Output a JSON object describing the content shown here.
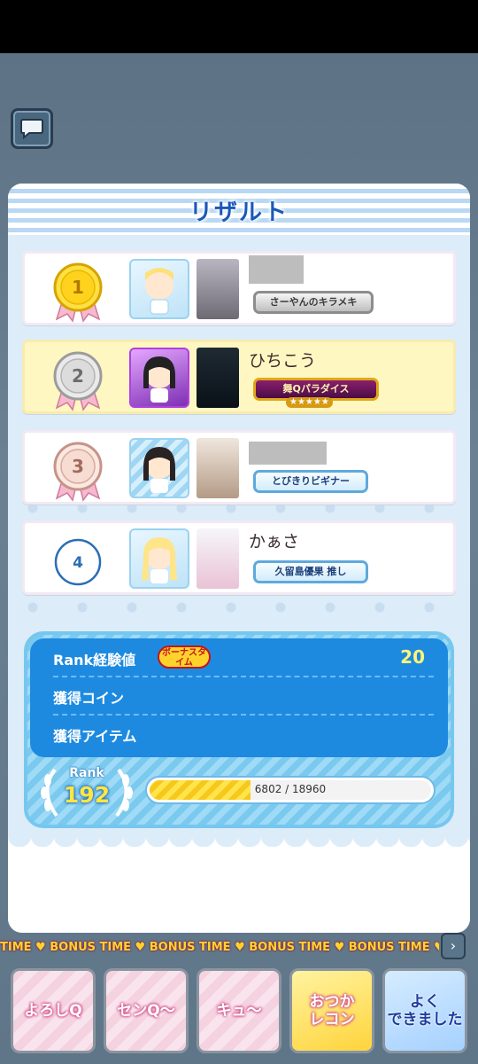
{
  "panel": {
    "title": "リザルト"
  },
  "results": [
    {
      "rank": "1",
      "name": "",
      "title": "さーやんのキラメキ",
      "highlight": false
    },
    {
      "rank": "2",
      "name": "ひちこう",
      "title": "舞Qパラダイス",
      "highlight": true
    },
    {
      "rank": "3",
      "name": "",
      "title": "とびきりビギナー",
      "highlight": false
    },
    {
      "rank": "4",
      "name": "かぁさ",
      "title": "久留島優果 推し",
      "highlight": false
    }
  ],
  "stats": {
    "rank_exp_label": "Rank経験値",
    "bonus_badge": "ボーナスタイム",
    "rank_exp_value": "20",
    "coin_label": "獲得コイン",
    "item_label": "獲得アイテム"
  },
  "rank": {
    "label": "Rank",
    "value": "192",
    "exp_text": "6802 / 18960",
    "exp_current": 6802,
    "exp_total": 18960
  },
  "ticker": {
    "text": "TIME ♥ BONUS TIME ♥ BONUS TIME ♥ BONUS TIME ♥ BONUS TIME ♥ BONUS TIM"
  },
  "stamps": [
    {
      "label": "よろしQ"
    },
    {
      "label": "センQ〜"
    },
    {
      "label": "キュ〜"
    },
    {
      "label": "おつか\nレコン"
    },
    {
      "label": "よく\nできました"
    }
  ],
  "colors": {
    "accent": "#1d8ae0",
    "title": "#1b58b8",
    "highlight_row": "#fff7c2",
    "gold": "#f2c200"
  }
}
